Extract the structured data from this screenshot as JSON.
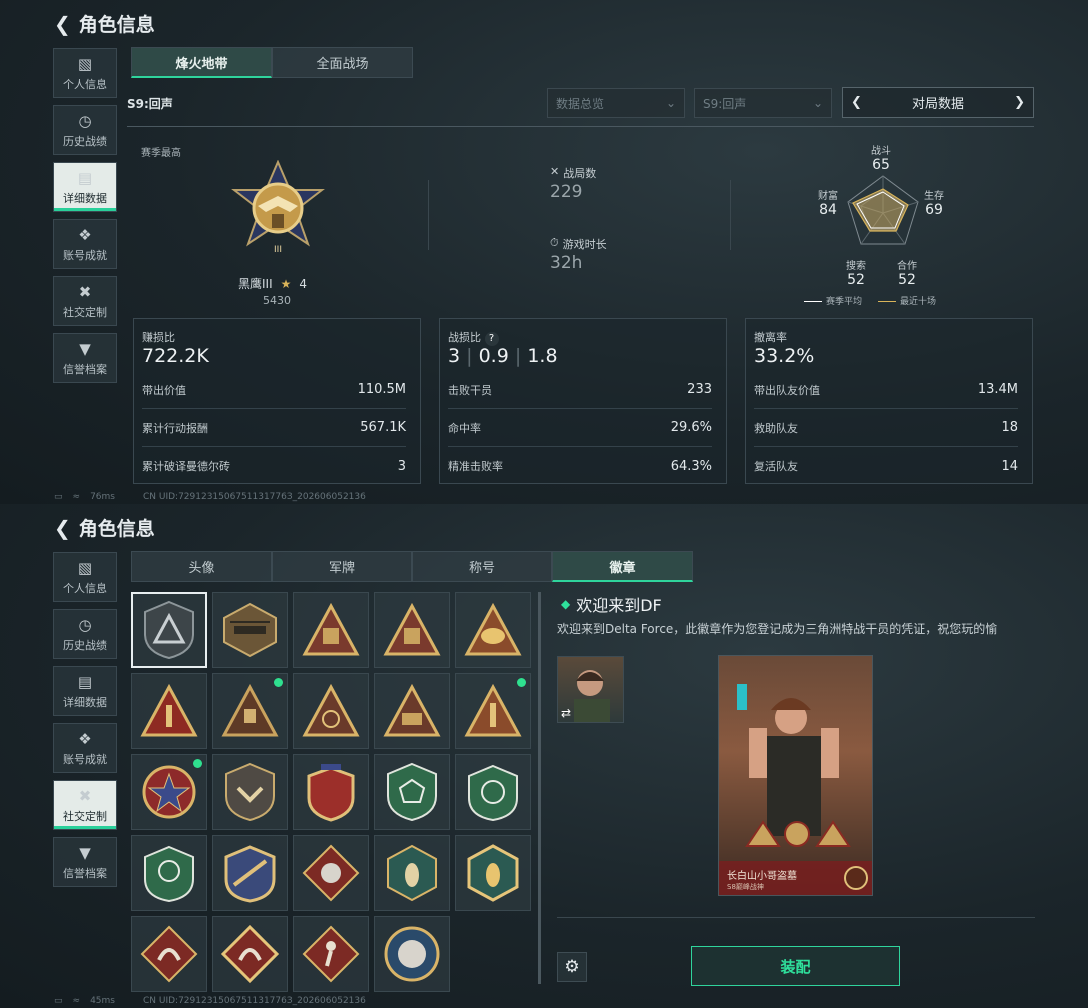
{
  "header": {
    "title": "角色信息"
  },
  "sidebar": {
    "items": [
      {
        "label": "个人信息",
        "icon": "bar-chart-icon"
      },
      {
        "label": "历史战绩",
        "icon": "history-icon"
      },
      {
        "label": "详细数据",
        "icon": "folder-icon"
      },
      {
        "label": "账号成就",
        "icon": "achievement-icon"
      },
      {
        "label": "社交定制",
        "icon": "tools-icon"
      },
      {
        "label": "信誉档案",
        "icon": "shield-icon"
      }
    ]
  },
  "top": {
    "tabs": [
      "烽火地带",
      "全面战场"
    ],
    "season": "S9:回声",
    "dropdowns": [
      "数据总览",
      "S9:回声"
    ],
    "pager": "对局数据",
    "rank_caption": "赛季最高",
    "rank_name": "黑鹰III",
    "rank_stars": "4",
    "rank_score": "5430",
    "battles_label": "战局数",
    "battles_value": "229",
    "playtime_label": "游戏时长",
    "playtime_value": "32h",
    "radar": {
      "combat": {
        "label": "战斗",
        "value": "65"
      },
      "survival": {
        "label": "生存",
        "value": "69"
      },
      "teamwork": {
        "label": "合作",
        "value": "52"
      },
      "search": {
        "label": "搜索",
        "value": "52"
      },
      "wealth": {
        "label": "财富",
        "value": "84"
      },
      "legend_avg": "赛季平均",
      "legend_recent": "最近十场",
      "colors": {
        "avg": "#ffffff",
        "recent": "#d9b45a"
      }
    },
    "box1": {
      "title": "赚损比",
      "value": "722.2K",
      "rows": [
        {
          "label": "带出价值",
          "value": "110.5M"
        },
        {
          "label": "累计行动报酬",
          "value": "567.1K"
        },
        {
          "label": "累计破译曼德尔砖",
          "value": "3"
        }
      ]
    },
    "box2": {
      "title": "战损比",
      "help": "?",
      "v1": "3",
      "v2": "0.9",
      "v3": "1.8",
      "rows": [
        {
          "label": "击败干员",
          "value": "233"
        },
        {
          "label": "命中率",
          "value": "29.6%"
        },
        {
          "label": "精准击败率",
          "value": "64.3%"
        }
      ]
    },
    "box3": {
      "title": "撤离率",
      "value": "33.2%",
      "rows": [
        {
          "label": "带出队友价值",
          "value": "13.4M"
        },
        {
          "label": "救助队友",
          "value": "18"
        },
        {
          "label": "复活队友",
          "value": "14"
        }
      ]
    },
    "footer": {
      "ping": "76ms",
      "uid": "CN UID:7291231506751131776З_202606052136"
    }
  },
  "bottom": {
    "tabs": [
      "头像",
      "军牌",
      "称号",
      "徽章"
    ],
    "badge_title": "欢迎来到DF",
    "badge_desc": "欢迎来到Delta Force，此徽章作为您登记成为三角洲特战干员的凭证，祝您玩的愉",
    "card_name": "长白山小哥盗墓",
    "card_sub": "S8巅峰战神",
    "equip": "装配",
    "footer": {
      "ping": "45ms",
      "uid": "CN UID:7291231506751131776З_202606052136"
    },
    "accent": "#2fd49c"
  }
}
